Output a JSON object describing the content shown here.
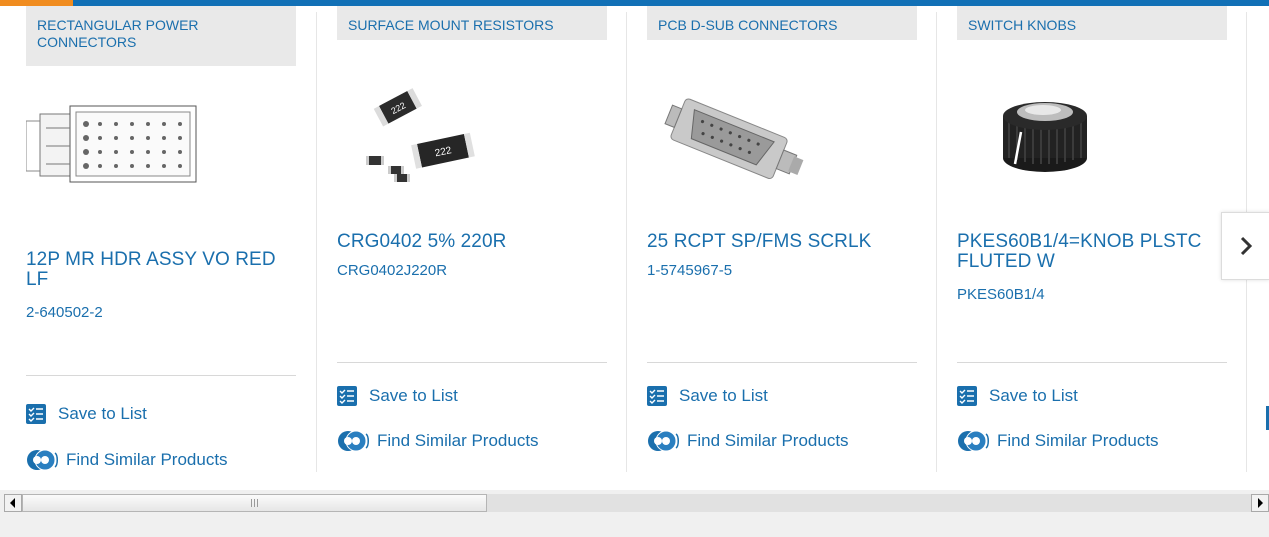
{
  "colors": {
    "accent_blue": "#1170b6",
    "accent_orange": "#f08c1f",
    "link_blue": "#1a6fad"
  },
  "cards": [
    {
      "category": "RECTANGULAR POWER CONNECTORS",
      "title": "12P MR HDR ASSY VO RED LF",
      "part_number": "2-640502-2",
      "save_label": "Save to List",
      "find_label": "Find Similar Products"
    },
    {
      "category": "SURFACE MOUNT RESISTORS",
      "title": "CRG0402 5% 220R",
      "part_number": "CRG0402J220R",
      "save_label": "Save to List",
      "find_label": "Find Similar Products"
    },
    {
      "category": "PCB D-SUB CONNECTORS",
      "title": "25 RCPT SP/FMS SCRLK",
      "part_number": "1-5745967-5",
      "save_label": "Save to List",
      "find_label": "Find Similar Products"
    },
    {
      "category": "SWITCH KNOBS",
      "title": "PKES60B1/4=KNOB PLSTC FLUTED W",
      "part_number": "PKES60B1/4",
      "save_label": "Save to List",
      "find_label": "Find Similar Products"
    }
  ],
  "resistor_labels": [
    "222",
    "222"
  ],
  "icons": {
    "save": "checklist-icon",
    "find": "find-similar-icon",
    "next": "chevron-right-icon"
  }
}
